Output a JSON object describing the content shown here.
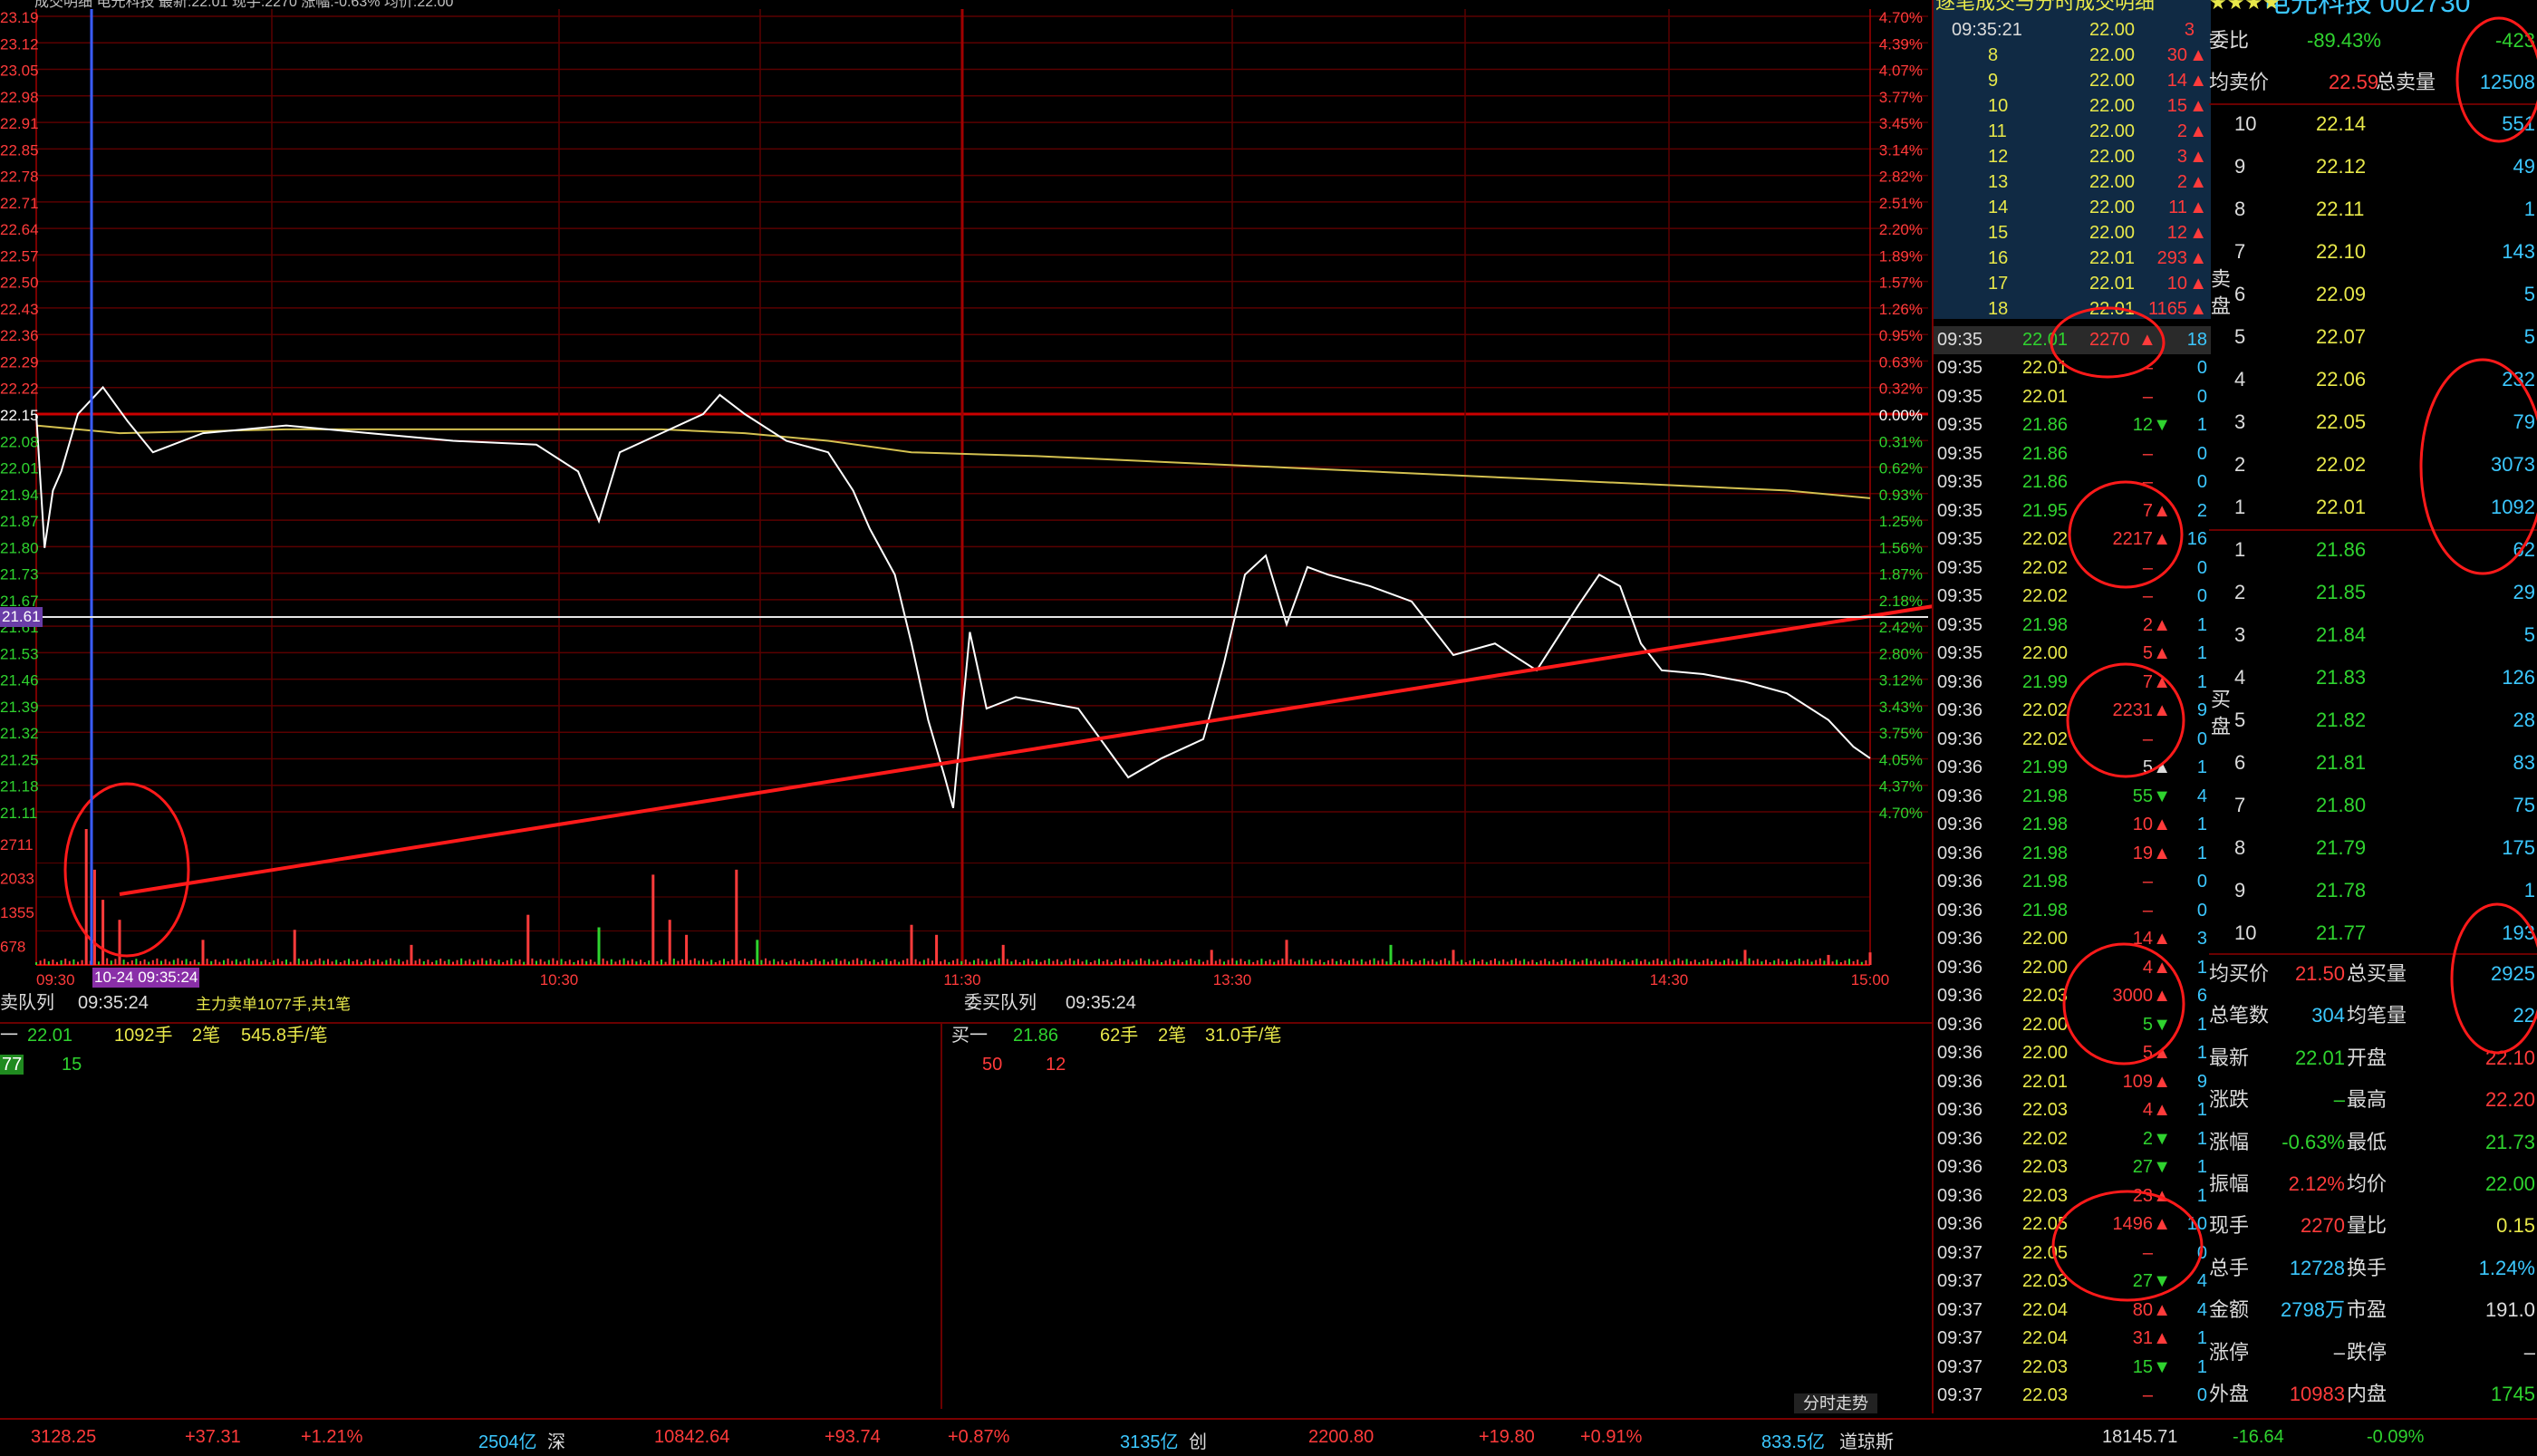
{
  "colors": {
    "up": "#ff3b3b",
    "down": "#2fd32f",
    "grid": "#8a0000",
    "price_line": "#ffffff",
    "avg_line": "#d4c150",
    "trend_line": "#ff2020",
    "annotation": "#ff0000"
  },
  "top_bar": {
    "title": "成交明细 电光科技 最新:22.01 现手:2270 涨幅:-0.63% 均价:22.00"
  },
  "chart_data": {
    "type": "line",
    "title": "电光科技 分时走势",
    "x_ticks": [
      "09:30",
      "10:30",
      "11:30",
      "13:30",
      "14:30",
      "15:00"
    ],
    "y_price_ticks": [
      "23.19",
      "23.12",
      "23.05",
      "22.98",
      "22.91",
      "22.85",
      "22.78",
      "22.71",
      "22.64",
      "22.57",
      "22.50",
      "22.43",
      "22.36",
      "22.29",
      "22.22",
      "22.15",
      "22.08",
      "22.01",
      "21.94",
      "21.87",
      "21.80",
      "21.73",
      "21.67",
      "21.61",
      "21.53",
      "21.46",
      "21.39",
      "21.32",
      "21.25",
      "21.18",
      "21.11"
    ],
    "y_pct_ticks": [
      "4.70%",
      "4.39%",
      "4.07%",
      "3.77%",
      "3.45%",
      "3.14%",
      "2.82%",
      "2.51%",
      "2.20%",
      "1.89%",
      "1.57%",
      "1.26%",
      "0.95%",
      "0.63%",
      "0.32%",
      "0.00%",
      "0.31%",
      "0.62%",
      "0.93%",
      "1.25%",
      "1.56%",
      "1.87%",
      "2.18%",
      "2.42%",
      "2.80%",
      "3.12%",
      "3.43%",
      "3.75%",
      "4.05%",
      "4.37%",
      "4.70%"
    ],
    "y_volume_ticks": [
      "2711",
      "2033",
      "1355",
      "678"
    ],
    "ylim": [
      21.11,
      23.19
    ],
    "prev_close": 22.15,
    "crosshair_price": "21.61",
    "crosshair_time": "10-24 09:35:24",
    "price_series": [
      [
        0,
        22.15
      ],
      [
        2,
        21.8
      ],
      [
        4,
        21.95
      ],
      [
        6,
        22.0
      ],
      [
        10,
        22.15
      ],
      [
        16,
        22.22
      ],
      [
        22,
        22.13
      ],
      [
        28,
        22.05
      ],
      [
        40,
        22.1
      ],
      [
        60,
        22.12
      ],
      [
        80,
        22.1
      ],
      [
        100,
        22.08
      ],
      [
        120,
        22.07
      ],
      [
        130,
        22.0
      ],
      [
        135,
        21.87
      ],
      [
        140,
        22.05
      ],
      [
        150,
        22.1
      ],
      [
        160,
        22.15
      ],
      [
        164,
        22.2
      ],
      [
        170,
        22.15
      ],
      [
        180,
        22.08
      ],
      [
        190,
        22.05
      ],
      [
        196,
        21.95
      ],
      [
        200,
        21.85
      ],
      [
        206,
        21.73
      ],
      [
        210,
        21.55
      ],
      [
        214,
        21.35
      ],
      [
        218,
        21.2
      ],
      [
        220,
        21.12
      ],
      [
        224,
        21.58
      ],
      [
        228,
        21.38
      ],
      [
        235,
        21.41
      ],
      [
        250,
        21.38
      ],
      [
        262,
        21.2
      ],
      [
        270,
        21.25
      ],
      [
        280,
        21.3
      ],
      [
        285,
        21.5
      ],
      [
        290,
        21.73
      ],
      [
        295,
        21.78
      ],
      [
        300,
        21.6
      ],
      [
        305,
        21.75
      ],
      [
        310,
        21.73
      ],
      [
        320,
        21.7
      ],
      [
        330,
        21.66
      ],
      [
        340,
        21.52
      ],
      [
        350,
        21.55
      ],
      [
        360,
        21.48
      ],
      [
        370,
        21.65
      ],
      [
        375,
        21.73
      ],
      [
        380,
        21.7
      ],
      [
        385,
        21.55
      ],
      [
        390,
        21.48
      ],
      [
        400,
        21.47
      ],
      [
        410,
        21.45
      ],
      [
        420,
        21.42
      ],
      [
        430,
        21.35
      ],
      [
        436,
        21.28
      ],
      [
        440,
        21.25
      ]
    ],
    "avg_series": [
      [
        0,
        22.12
      ],
      [
        20,
        22.1
      ],
      [
        60,
        22.11
      ],
      [
        120,
        22.11
      ],
      [
        150,
        22.11
      ],
      [
        170,
        22.1
      ],
      [
        190,
        22.08
      ],
      [
        210,
        22.05
      ],
      [
        240,
        22.04
      ],
      [
        300,
        22.01
      ],
      [
        360,
        21.98
      ],
      [
        420,
        21.95
      ],
      [
        440,
        21.93
      ]
    ],
    "volume_series": [
      [
        12,
        2711
      ],
      [
        14,
        1900
      ],
      [
        16,
        1300
      ],
      [
        20,
        900
      ],
      [
        40,
        500
      ],
      [
        62,
        700
      ],
      [
        90,
        400
      ],
      [
        118,
        1000
      ],
      [
        135,
        750
      ],
      [
        148,
        1800
      ],
      [
        152,
        900
      ],
      [
        156,
        600
      ],
      [
        168,
        1900
      ],
      [
        173,
        500
      ],
      [
        210,
        800
      ],
      [
        216,
        600
      ],
      [
        232,
        400
      ],
      [
        282,
        300
      ],
      [
        300,
        500
      ],
      [
        325,
        400
      ],
      [
        340,
        300
      ],
      [
        410,
        300
      ],
      [
        430,
        200
      ],
      [
        440,
        250
      ]
    ]
  },
  "detail": {
    "header_title": "逐笔成交与分时成交明细",
    "clock": "09:35:21",
    "top_rows": [
      {
        "n": "8",
        "p": "22.00",
        "v": "30",
        "d": "up"
      },
      {
        "n": "9",
        "p": "22.00",
        "v": "14",
        "d": "up"
      },
      {
        "n": "10",
        "p": "22.00",
        "v": "15",
        "d": "up"
      },
      {
        "n": "11",
        "p": "22.00",
        "v": "2",
        "d": "up"
      },
      {
        "n": "12",
        "p": "22.00",
        "v": "3",
        "d": "up"
      },
      {
        "n": "13",
        "p": "22.00",
        "v": "2",
        "d": "up"
      },
      {
        "n": "14",
        "p": "22.00",
        "v": "11",
        "d": "up"
      },
      {
        "n": "15",
        "p": "22.00",
        "v": "12",
        "d": "up"
      },
      {
        "n": "16",
        "p": "22.01",
        "v": "293",
        "d": "up"
      },
      {
        "n": "17",
        "p": "22.01",
        "v": "10",
        "d": "up"
      },
      {
        "n": "18",
        "p": "22.01",
        "v": "1165",
        "d": "up"
      }
    ],
    "first_row": {
      "p": "22.00",
      "v": "3"
    },
    "highlight": {
      "t": "09:35",
      "p": "22.01",
      "v": "2270",
      "c": "18"
    },
    "rows": [
      {
        "t": "09:35",
        "p": "22.01",
        "v": "–",
        "c": "0",
        "d": "none"
      },
      {
        "t": "09:35",
        "p": "22.01",
        "v": "–",
        "c": "0",
        "d": "none"
      },
      {
        "t": "09:35",
        "p": "21.86",
        "v": "12",
        "c": "1",
        "d": "down"
      },
      {
        "t": "09:35",
        "p": "21.86",
        "v": "–",
        "c": "0",
        "d": "none"
      },
      {
        "t": "09:35",
        "p": "21.86",
        "v": "–",
        "c": "0",
        "d": "none"
      },
      {
        "t": "09:35",
        "p": "21.95",
        "v": "7",
        "c": "2",
        "d": "up"
      },
      {
        "t": "09:35",
        "p": "22.02",
        "v": "2217",
        "c": "16",
        "d": "up"
      },
      {
        "t": "09:35",
        "p": "22.02",
        "v": "–",
        "c": "0",
        "d": "none"
      },
      {
        "t": "09:35",
        "p": "22.02",
        "v": "–",
        "c": "0",
        "d": "none"
      },
      {
        "t": "09:35",
        "p": "21.98",
        "v": "2",
        "c": "1",
        "d": "up"
      },
      {
        "t": "09:35",
        "p": "22.00",
        "v": "5",
        "c": "1",
        "d": "up"
      },
      {
        "t": "09:36",
        "p": "21.99",
        "v": "7",
        "c": "1",
        "d": "up"
      },
      {
        "t": "09:36",
        "p": "22.02",
        "v": "2231",
        "c": "9",
        "d": "up"
      },
      {
        "t": "09:36",
        "p": "22.02",
        "v": "–",
        "c": "0",
        "d": "none"
      },
      {
        "t": "09:36",
        "p": "21.99",
        "v": "5",
        "c": "1",
        "d": "white"
      },
      {
        "t": "09:36",
        "p": "21.98",
        "v": "55",
        "c": "4",
        "d": "down"
      },
      {
        "t": "09:36",
        "p": "21.98",
        "v": "10",
        "c": "1",
        "d": "up"
      },
      {
        "t": "09:36",
        "p": "21.98",
        "v": "19",
        "c": "1",
        "d": "up"
      },
      {
        "t": "09:36",
        "p": "21.98",
        "v": "–",
        "c": "0",
        "d": "none"
      },
      {
        "t": "09:36",
        "p": "21.98",
        "v": "–",
        "c": "0",
        "d": "none"
      },
      {
        "t": "09:36",
        "p": "22.00",
        "v": "14",
        "c": "3",
        "d": "up"
      },
      {
        "t": "09:36",
        "p": "22.00",
        "v": "4",
        "c": "1",
        "d": "up"
      },
      {
        "t": "09:36",
        "p": "22.03",
        "v": "3000",
        "c": "6",
        "d": "up"
      },
      {
        "t": "09:36",
        "p": "22.00",
        "v": "5",
        "c": "1",
        "d": "down"
      },
      {
        "t": "09:36",
        "p": "22.00",
        "v": "5",
        "c": "1",
        "d": "up"
      },
      {
        "t": "09:36",
        "p": "22.01",
        "v": "109",
        "c": "9",
        "d": "up"
      },
      {
        "t": "09:36",
        "p": "22.03",
        "v": "4",
        "c": "1",
        "d": "up"
      },
      {
        "t": "09:36",
        "p": "22.02",
        "v": "2",
        "c": "1",
        "d": "down"
      },
      {
        "t": "09:36",
        "p": "22.03",
        "v": "27",
        "c": "1",
        "d": "down"
      },
      {
        "t": "09:36",
        "p": "22.03",
        "v": "23",
        "c": "1",
        "d": "up"
      },
      {
        "t": "09:36",
        "p": "22.05",
        "v": "1496",
        "c": "10",
        "d": "up"
      },
      {
        "t": "09:37",
        "p": "22.05",
        "v": "–",
        "c": "0",
        "d": "none"
      },
      {
        "t": "09:37",
        "p": "22.03",
        "v": "27",
        "c": "4",
        "d": "down"
      },
      {
        "t": "09:37",
        "p": "22.04",
        "v": "80",
        "c": "4",
        "d": "up"
      },
      {
        "t": "09:37",
        "p": "22.04",
        "v": "31",
        "c": "1",
        "d": "up"
      },
      {
        "t": "09:37",
        "p": "22.03",
        "v": "15",
        "c": "1",
        "d": "down"
      },
      {
        "t": "09:37",
        "p": "22.03",
        "v": "–",
        "c": "0",
        "d": "none"
      }
    ]
  },
  "quote": {
    "header": "电光科技 002730",
    "wei_bi": {
      "label": "委比",
      "value": "-89.43%",
      "extra": "-423"
    },
    "jun_mai_jia": {
      "label": "均卖价",
      "value": "22.59",
      "label2": "总卖量",
      "value2": "12508"
    },
    "sell": [
      {
        "n": "10",
        "p": "22.14",
        "v": "551"
      },
      {
        "n": "9",
        "p": "22.12",
        "v": "49"
      },
      {
        "n": "8",
        "p": "22.11",
        "v": "1"
      },
      {
        "n": "7",
        "p": "22.10",
        "v": "143"
      },
      {
        "n": "6",
        "p": "22.09",
        "v": "5"
      },
      {
        "n": "5",
        "p": "22.07",
        "v": "5"
      },
      {
        "n": "4",
        "p": "22.06",
        "v": "232"
      },
      {
        "n": "3",
        "p": "22.05",
        "v": "79"
      },
      {
        "n": "2",
        "p": "22.02",
        "v": "3073"
      },
      {
        "n": "1",
        "p": "22.01",
        "v": "1092"
      }
    ],
    "buy": [
      {
        "n": "1",
        "p": "21.86",
        "v": "62"
      },
      {
        "n": "2",
        "p": "21.85",
        "v": "29"
      },
      {
        "n": "3",
        "p": "21.84",
        "v": "5"
      },
      {
        "n": "4",
        "p": "21.83",
        "v": "126"
      },
      {
        "n": "5",
        "p": "21.82",
        "v": "28"
      },
      {
        "n": "6",
        "p": "21.81",
        "v": "83"
      },
      {
        "n": "7",
        "p": "21.80",
        "v": "75"
      },
      {
        "n": "8",
        "p": "21.79",
        "v": "175"
      },
      {
        "n": "9",
        "p": "21.78",
        "v": "1"
      },
      {
        "n": "10",
        "p": "21.77",
        "v": "193"
      }
    ],
    "side_sell": "卖盘",
    "side_buy": "买盘",
    "stats": [
      {
        "l1": "均买价",
        "v1": "21.50",
        "l2": "总买量",
        "v2": "2925",
        "c1": "up",
        "c2": "cy"
      },
      {
        "l1": "总笔数",
        "v1": "304",
        "l2": "均笔量",
        "v2": "22",
        "c1": "cy",
        "c2": "cy"
      },
      {
        "l1": "最新",
        "v1": "22.01",
        "l2": "开盘",
        "v2": "22.10",
        "c1": "dn",
        "c2": "up"
      },
      {
        "l1": "涨跌",
        "v1": "–",
        "l2": "最高",
        "v2": "22.20",
        "c1": "dn",
        "c2": "up"
      },
      {
        "l1": "涨幅",
        "v1": "-0.63%",
        "l2": "最低",
        "v2": "21.73",
        "c1": "dn",
        "c2": "dn"
      },
      {
        "l1": "振幅",
        "v1": "2.12%",
        "l2": "均价",
        "v2": "22.00",
        "c1": "up",
        "c2": "dn"
      },
      {
        "l1": "现手",
        "v1": "2270",
        "l2": "量比",
        "v2": "0.15",
        "c1": "up",
        "c2": "yl"
      },
      {
        "l1": "总手",
        "v1": "12728",
        "l2": "换手",
        "v2": "1.24%",
        "c1": "cy",
        "c2": "cy"
      },
      {
        "l1": "金额",
        "v1": "2798万",
        "l2": "市盈",
        "v2": "191.0",
        "c1": "cy",
        "c2": "wt"
      },
      {
        "l1": "涨停",
        "v1": "–",
        "l2": "跌停",
        "v2": "–",
        "c1": "wt",
        "c2": "wt"
      },
      {
        "l1": "外盘",
        "v1": "10983",
        "l2": "内盘",
        "v2": "1745",
        "c1": "up",
        "c2": "dn"
      }
    ]
  },
  "queues": {
    "sell_title": "卖队列",
    "sell_time": "09:35:24",
    "sell_note": "主力卖单1077手,共1笔",
    "sell_level": "一",
    "sell_price": "22.01",
    "sell_total": "1092手",
    "sell_count": "2笔",
    "sell_avg": "545.8手/笔",
    "sell_orders": [
      "77",
      "15"
    ],
    "buy_title": "委买队列",
    "buy_time": "09:35:24",
    "buy_level": "买一",
    "buy_price": "21.86",
    "buy_total": "62手",
    "buy_count": "2笔",
    "buy_avg": "31.0手/笔",
    "buy_orders": [
      "50",
      "12"
    ],
    "fenshi_button": "分时走势"
  },
  "index_bar": {
    "sh_value": "3128.25",
    "sh_change": "+37.31",
    "sh_pct": "+1.21%",
    "sh_amount": "2504亿",
    "sz_label": "深",
    "sz_value": "10842.64",
    "sz_change": "+93.74",
    "sz_pct": "+0.87%",
    "sz_amount": "3135亿",
    "cy_label": "创",
    "cy_value": "2200.80",
    "cy_change": "+19.80",
    "cy_pct": "+0.91%",
    "cy_amount": "833.5亿",
    "dj_label": "道琼斯",
    "dj_value": "18145.71",
    "dj_change": "-16.64",
    "dj_pct": "-0.09%"
  }
}
